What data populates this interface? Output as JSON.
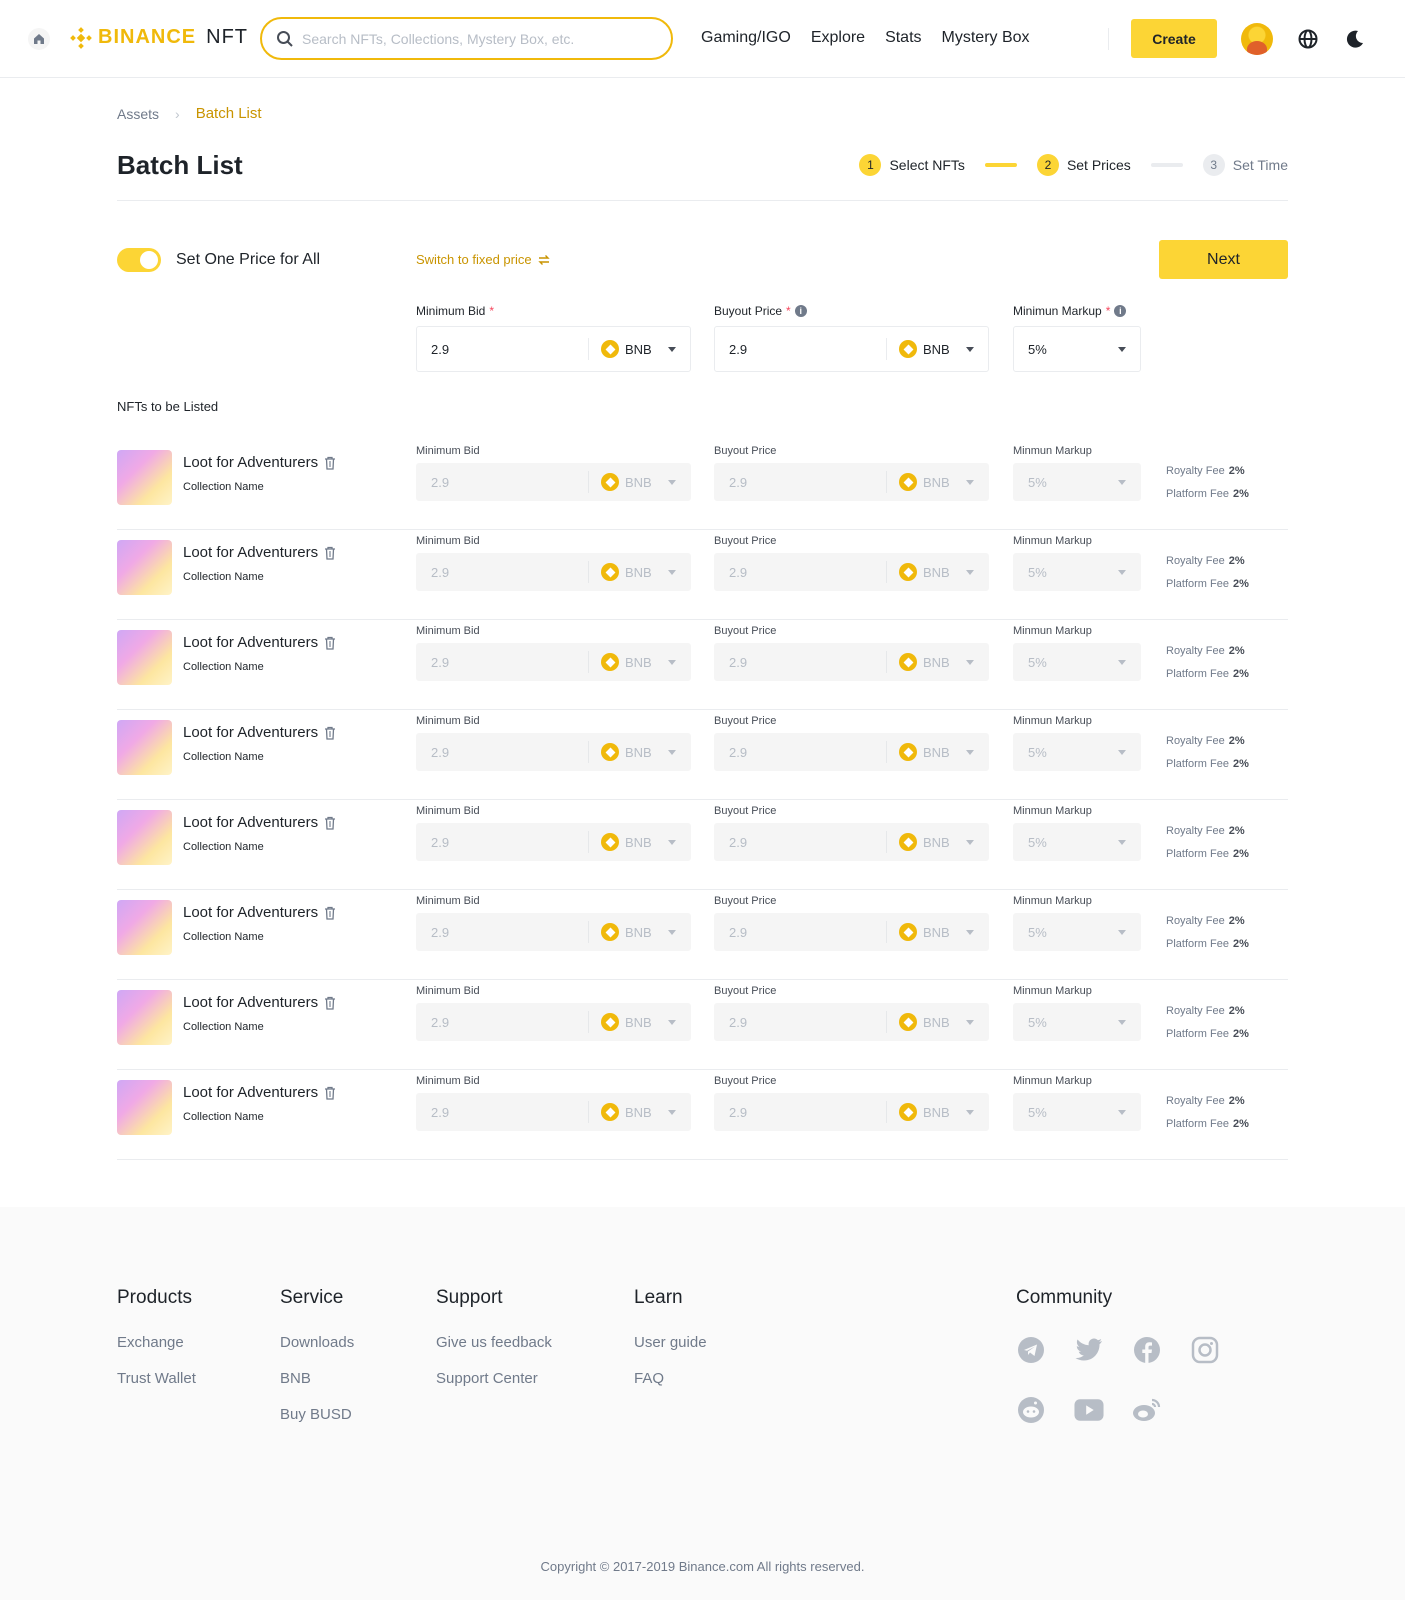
{
  "header": {
    "logo_text": "BINANCE",
    "logo_nft": "NFT",
    "search_placeholder": "Search NFTs, Collections, Mystery Box, etc.",
    "nav": [
      "Gaming/IGO",
      "Explore",
      "Stats",
      "Mystery Box"
    ],
    "create_label": "Create"
  },
  "breadcrumb": {
    "parent": "Assets",
    "current": "Batch List"
  },
  "page": {
    "title": "Batch List"
  },
  "steps": [
    {
      "num": "1",
      "label": "Select NFTs",
      "state": "active"
    },
    {
      "num": "2",
      "label": "Set Prices",
      "state": "active"
    },
    {
      "num": "3",
      "label": "Set Time",
      "state": "inactive"
    }
  ],
  "controls": {
    "toggle_label": "Set One Price for All",
    "switch_link": "Switch to fixed price",
    "next_label": "Next",
    "min_bid_label": "Minimum Bid",
    "buyout_label": "Buyout Price",
    "markup_label": "Minimun Markup",
    "min_bid_value": "2.9",
    "buyout_value": "2.9",
    "currency": "BNB",
    "markup_value": "5%"
  },
  "list": {
    "heading": "NFTs to be Listed",
    "row_min_bid_label": "Minimum Bid",
    "row_buyout_label": "Buyout Price",
    "row_markup_label": "Minmun Markup",
    "items": [
      {
        "name": "Loot for Adventurers",
        "collection": "Collection Name",
        "min_bid": "2.9",
        "buyout": "2.9",
        "currency": "BNB",
        "markup": "5%",
        "royalty_label": "Royalty Fee",
        "royalty": "2%",
        "platform_label": "Platform Fee",
        "platform": "2%"
      },
      {
        "name": "Loot for Adventurers",
        "collection": "Collection Name",
        "min_bid": "2.9",
        "buyout": "2.9",
        "currency": "BNB",
        "markup": "5%",
        "royalty_label": "Royalty Fee",
        "royalty": "2%",
        "platform_label": "Platform Fee",
        "platform": "2%"
      },
      {
        "name": "Loot for Adventurers",
        "collection": "Collection Name",
        "min_bid": "2.9",
        "buyout": "2.9",
        "currency": "BNB",
        "markup": "5%",
        "royalty_label": "Royalty Fee",
        "royalty": "2%",
        "platform_label": "Platform Fee",
        "platform": "2%"
      },
      {
        "name": "Loot for Adventurers",
        "collection": "Collection Name",
        "min_bid": "2.9",
        "buyout": "2.9",
        "currency": "BNB",
        "markup": "5%",
        "royalty_label": "Royalty Fee",
        "royalty": "2%",
        "platform_label": "Platform Fee",
        "platform": "2%"
      },
      {
        "name": "Loot for Adventurers",
        "collection": "Collection Name",
        "min_bid": "2.9",
        "buyout": "2.9",
        "currency": "BNB",
        "markup": "5%",
        "royalty_label": "Royalty Fee",
        "royalty": "2%",
        "platform_label": "Platform Fee",
        "platform": "2%"
      },
      {
        "name": "Loot for Adventurers",
        "collection": "Collection Name",
        "min_bid": "2.9",
        "buyout": "2.9",
        "currency": "BNB",
        "markup": "5%",
        "royalty_label": "Royalty Fee",
        "royalty": "2%",
        "platform_label": "Platform Fee",
        "platform": "2%"
      },
      {
        "name": "Loot for Adventurers",
        "collection": "Collection Name",
        "min_bid": "2.9",
        "buyout": "2.9",
        "currency": "BNB",
        "markup": "5%",
        "royalty_label": "Royalty Fee",
        "royalty": "2%",
        "platform_label": "Platform Fee",
        "platform": "2%"
      },
      {
        "name": "Loot for Adventurers",
        "collection": "Collection Name",
        "min_bid": "2.9",
        "buyout": "2.9",
        "currency": "BNB",
        "markup": "5%",
        "royalty_label": "Royalty Fee",
        "royalty": "2%",
        "platform_label": "Platform Fee",
        "platform": "2%"
      }
    ]
  },
  "footer": {
    "products": {
      "title": "Products",
      "links": [
        "Exchange",
        "Trust Wallet"
      ]
    },
    "service": {
      "title": "Service",
      "links": [
        "Downloads",
        "BNB",
        "Buy BUSD"
      ]
    },
    "support": {
      "title": "Support",
      "links": [
        "Give us feedback",
        "Support Center"
      ]
    },
    "learn": {
      "title": "Learn",
      "links": [
        "User guide",
        "FAQ"
      ]
    },
    "community": {
      "title": "Community",
      "icons": [
        "telegram-icon",
        "twitter-icon",
        "facebook-icon",
        "instagram-icon",
        "reddit-icon",
        "youtube-icon",
        "weibo-icon"
      ]
    },
    "copyright": "Copyright © 2017-2019 Binance.com All rights reserved."
  },
  "colors": {
    "brand": "#F0B90B",
    "accent": "#FCD535",
    "link": "#C99400",
    "required": "#F6465D"
  }
}
